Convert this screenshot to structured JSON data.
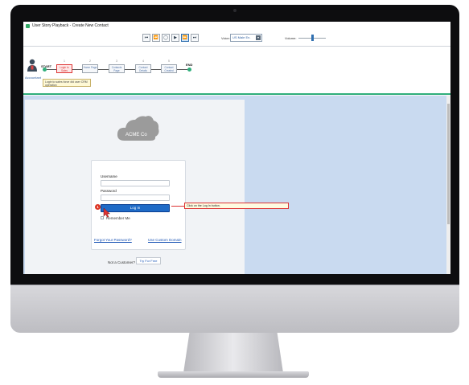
{
  "window": {
    "title": "User Story Playback - Create New Contact"
  },
  "toolbar": {
    "controls": [
      {
        "icon": "skip-start-icon",
        "glyph": "⏮"
      },
      {
        "icon": "rewind-icon",
        "glyph": "⏪"
      },
      {
        "icon": "stop-icon",
        "glyph": "◯"
      },
      {
        "icon": "play-icon",
        "glyph": "▶"
      },
      {
        "icon": "fast-forward-icon",
        "glyph": "⏩"
      },
      {
        "icon": "skip-end-icon",
        "glyph": "⏭"
      }
    ],
    "voice_label": "Voice:",
    "voice_value": "US Male En.",
    "volume_label": "Volume:"
  },
  "flow": {
    "actor": "Accountant",
    "start": "START",
    "end": "END",
    "steps": [
      {
        "num": "1",
        "label": "Login to Sales"
      },
      {
        "num": "2",
        "label": "Home Page"
      },
      {
        "num": "3",
        "label": "Contacts Page"
      },
      {
        "num": "4",
        "label": "Contact Details"
      },
      {
        "num": "5",
        "label": "Contact Created"
      }
    ],
    "tooltip": "Login to sales force did user CRM operation"
  },
  "login": {
    "brand": "ACME Co",
    "username_label": "Username",
    "password_label": "Password",
    "login_button": "Log In",
    "remember_label": "Remember Me",
    "forgot_link": "Forgot Your Password?",
    "custom_domain_link": "Use Custom Domain",
    "not_customer": "Not a Customer?",
    "try_free": "Try For Free",
    "step_badge": "1"
  },
  "callout": {
    "text": "Click on the Log In button."
  },
  "colors": {
    "accent": "#1f6bc7",
    "flow_border": "#2fae7a",
    "highlight": "#d33333"
  }
}
